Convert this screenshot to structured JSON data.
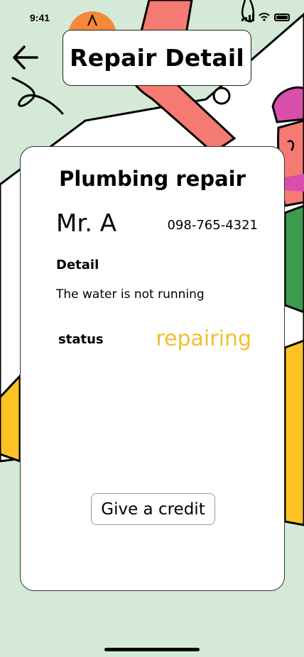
{
  "status_bar": {
    "time": "9:41"
  },
  "header": {
    "title": "Repair Detail"
  },
  "repair": {
    "title": "Plumbing repair",
    "customer_name": "Mr. A",
    "phone": "098-765-4321",
    "detail_label": "Detail",
    "detail_text": "The water is not running",
    "status_label": "status",
    "status_value": "repairing"
  },
  "actions": {
    "credit_button_label": "Give a credit"
  },
  "colors": {
    "background": "#d4ead7",
    "status_accent": "#f3be2c",
    "illustration_red": "#f47a72",
    "illustration_yellow": "#fdc325",
    "illustration_green": "#3a9d4d",
    "illustration_pink": "#d94dab",
    "illustration_orange": "#f5883a"
  },
  "icons": [
    "back-arrow-icon",
    "signal-icon",
    "wifi-icon",
    "battery-icon"
  ]
}
